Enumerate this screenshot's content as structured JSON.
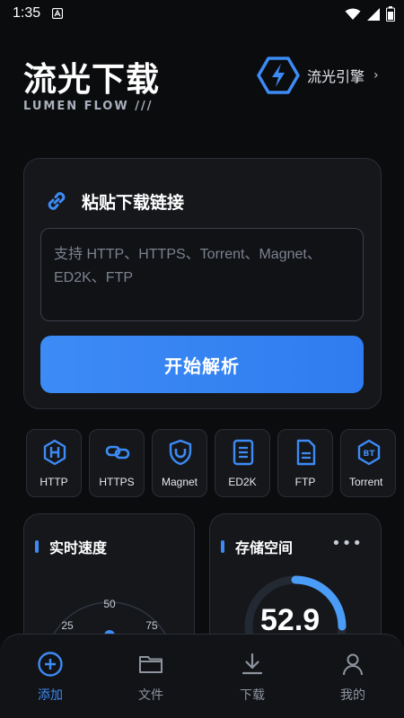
{
  "status": {
    "time": "1:35"
  },
  "header": {
    "title": "流光下载",
    "subtitle": "LUMEN FLOW  ///",
    "engine_label": "流光引擎",
    "engine_arrow": "›"
  },
  "paste": {
    "title": "粘贴下载链接",
    "placeholder": "支持 HTTP、HTTPS、Torrent、Magnet、ED2K、FTP",
    "button": "开始解析"
  },
  "protocols": [
    {
      "label": "HTTP",
      "icon": "http-hexagon-icon"
    },
    {
      "label": "HTTPS",
      "icon": "link-icon"
    },
    {
      "label": "Magnet",
      "icon": "magnet-shield-icon"
    },
    {
      "label": "ED2K",
      "icon": "document-icon"
    },
    {
      "label": "FTP",
      "icon": "file-icon"
    },
    {
      "label": "Torrent",
      "icon": "bt-icon"
    }
  ],
  "speed": {
    "title": "实时速度",
    "scale_labels": [
      "25",
      "50",
      "75"
    ]
  },
  "storage": {
    "title": "存储空间",
    "more": "•••",
    "value": "52.9"
  },
  "nav": [
    {
      "label": "添加",
      "icon": "add-circle-icon",
      "active": true
    },
    {
      "label": "文件",
      "icon": "folder-icon",
      "active": false
    },
    {
      "label": "下载",
      "icon": "download-icon",
      "active": false
    },
    {
      "label": "我的",
      "icon": "user-icon",
      "active": false
    }
  ],
  "colors": {
    "accent": "#3d8bf5",
    "background": "#0b0c0e",
    "card": "#15171b"
  }
}
